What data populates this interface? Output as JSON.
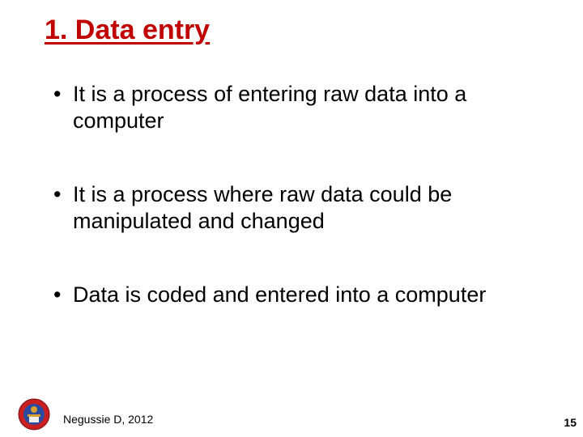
{
  "title": "1. Data entry",
  "bullets": [
    "It is a process of entering raw data into a computer",
    "It is a process where raw data could be manipulated and changed",
    "Data is coded and entered into a computer"
  ],
  "footer": {
    "author": "Negussie D, 2012",
    "page": "15"
  },
  "colors": {
    "title": "#c00000",
    "text": "#000000",
    "logo_red": "#c82020",
    "logo_blue": "#2a4aa0",
    "logo_gold": "#d8a030"
  }
}
